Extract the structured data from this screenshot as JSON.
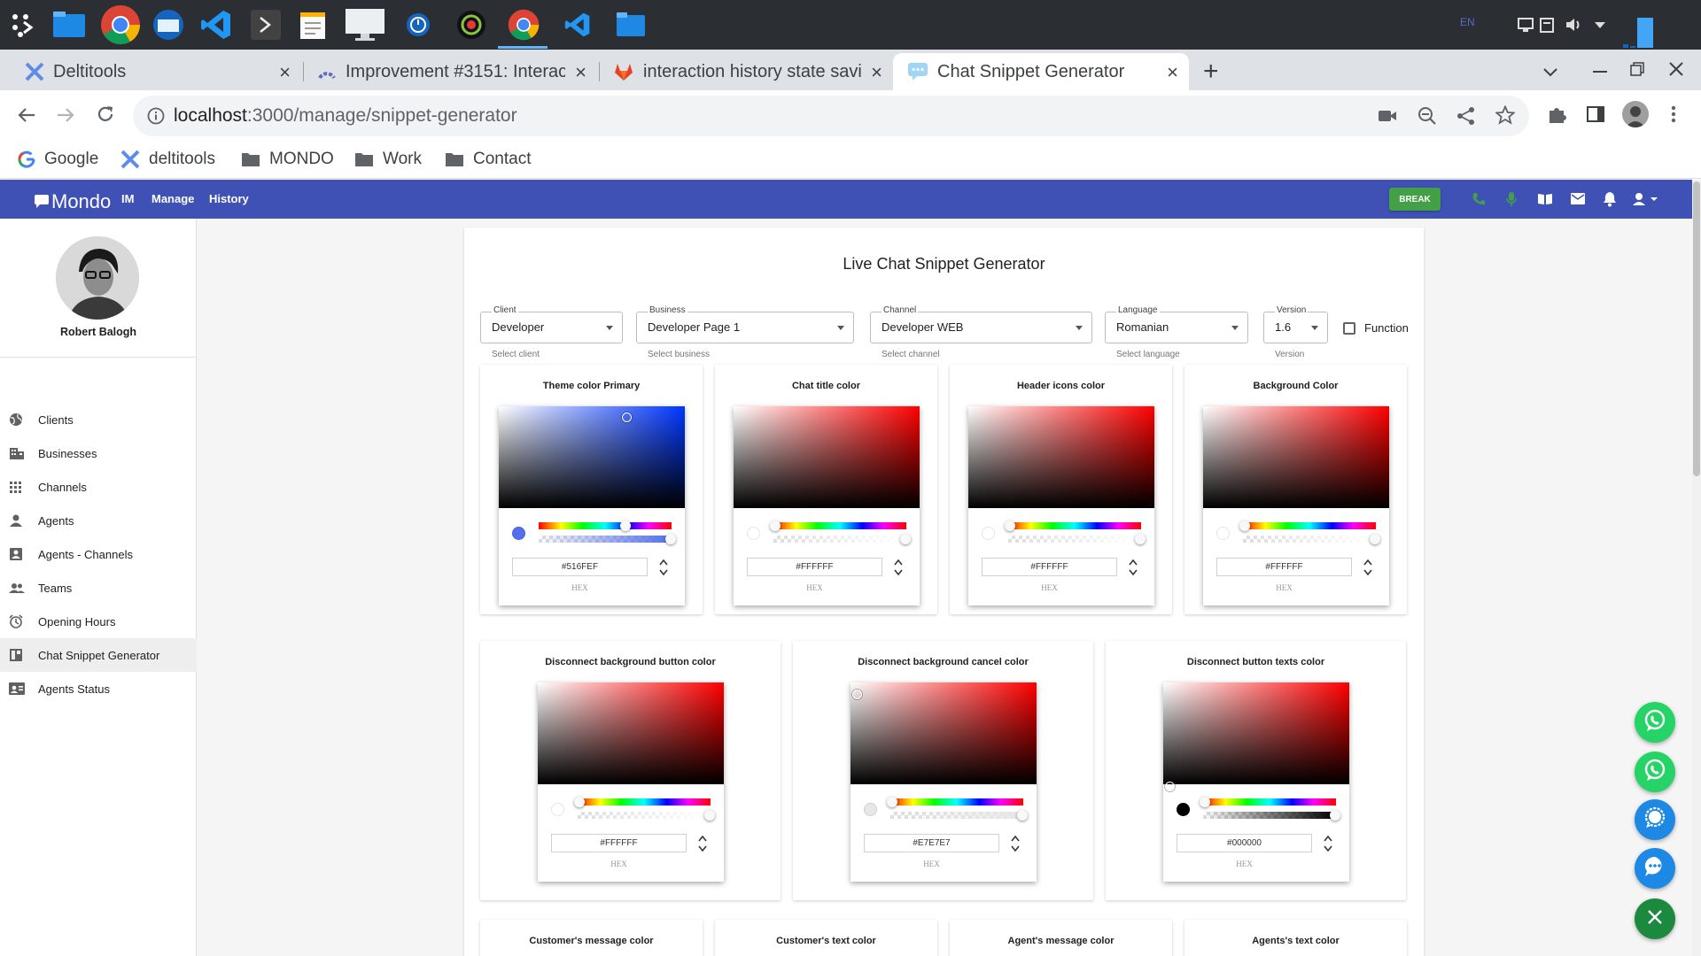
{
  "taskbar": {
    "lang": "EN"
  },
  "tabs": [
    {
      "title": "Deltitools",
      "close": "×"
    },
    {
      "title": "Improvement #3151: Interac",
      "close": "×"
    },
    {
      "title": "interaction history state savi",
      "close": "×"
    },
    {
      "title": "Chat Snippet Generator",
      "close": "×"
    }
  ],
  "browser": {
    "new_tab": "+",
    "url_host": "localhost",
    "url_path": ":3000/manage/snippet-generator"
  },
  "bookmarks": [
    {
      "label": "Google"
    },
    {
      "label": "deltitools"
    },
    {
      "label": "MONDO"
    },
    {
      "label": "Work"
    },
    {
      "label": "Contact"
    }
  ],
  "app": {
    "brand": "Mondo",
    "nav": [
      "IM",
      "Manage",
      "History"
    ],
    "break_label": "BREAK",
    "accent": "#3f51b5",
    "break_color": "#43a047"
  },
  "user": {
    "name": "Robert Balogh"
  },
  "sidebar": [
    {
      "label": "Clients",
      "icon": "globe-icon"
    },
    {
      "label": "Businesses",
      "icon": "business-icon"
    },
    {
      "label": "Channels",
      "icon": "grid-icon"
    },
    {
      "label": "Agents",
      "icon": "person-icon"
    },
    {
      "label": "Agents - Channels",
      "icon": "contact-icon"
    },
    {
      "label": "Teams",
      "icon": "people-icon"
    },
    {
      "label": "Opening Hours",
      "icon": "clock-icon"
    },
    {
      "label": "Chat Snippet Generator",
      "icon": "snippet-icon"
    },
    {
      "label": "Agents Status",
      "icon": "badge-icon"
    }
  ],
  "page": {
    "title": "Live Chat Snippet Generator",
    "fields": [
      {
        "label": "Client",
        "value": "Developer",
        "hint": "Select client"
      },
      {
        "label": "Business",
        "value": "Developer Page 1",
        "hint": "Select business"
      },
      {
        "label": "Channel",
        "value": "Developer WEB",
        "hint": "Select channel"
      },
      {
        "label": "Language",
        "value": "Romanian",
        "hint": "Select language"
      },
      {
        "label": "Version",
        "value": "1.6",
        "hint": "Version"
      }
    ],
    "function_label": "Function",
    "hex_label": "HEX",
    "pickers_row1": [
      {
        "title": "Theme color Primary",
        "hex": "#516FEF",
        "color": "#516FEF",
        "hue": "#0036ff"
      },
      {
        "title": "Chat title color",
        "hex": "#FFFFFF",
        "color": "#FFFFFF",
        "hue": "#ff0000"
      },
      {
        "title": "Header icons color",
        "hex": "#FFFFFF",
        "color": "#FFFFFF",
        "hue": "#ff0000"
      },
      {
        "title": "Background Color",
        "hex": "#FFFFFF",
        "color": "#FFFFFF",
        "hue": "#ff0000"
      }
    ],
    "pickers_row2": [
      {
        "title": "Disconnect background button color",
        "hex": "#FFFFFF",
        "color": "#FFFFFF",
        "hue": "#ff0000"
      },
      {
        "title": "Disconnect background cancel color",
        "hex": "#E7E7E7",
        "color": "#E7E7E7",
        "hue": "#ff0000"
      },
      {
        "title": "Disconnect button texts color",
        "hex": "#000000",
        "color": "#000000",
        "hue": "#ff0000"
      }
    ],
    "pickers_row3": [
      {
        "title": "Customer's message color"
      },
      {
        "title": "Customer's text color"
      },
      {
        "title": "Agent's message color"
      },
      {
        "title": "Agents's text color"
      }
    ]
  },
  "fab_colors": [
    "#25d366",
    "#25d366",
    "#1e88e5",
    "#1e88e5",
    "#1b8a3e"
  ]
}
